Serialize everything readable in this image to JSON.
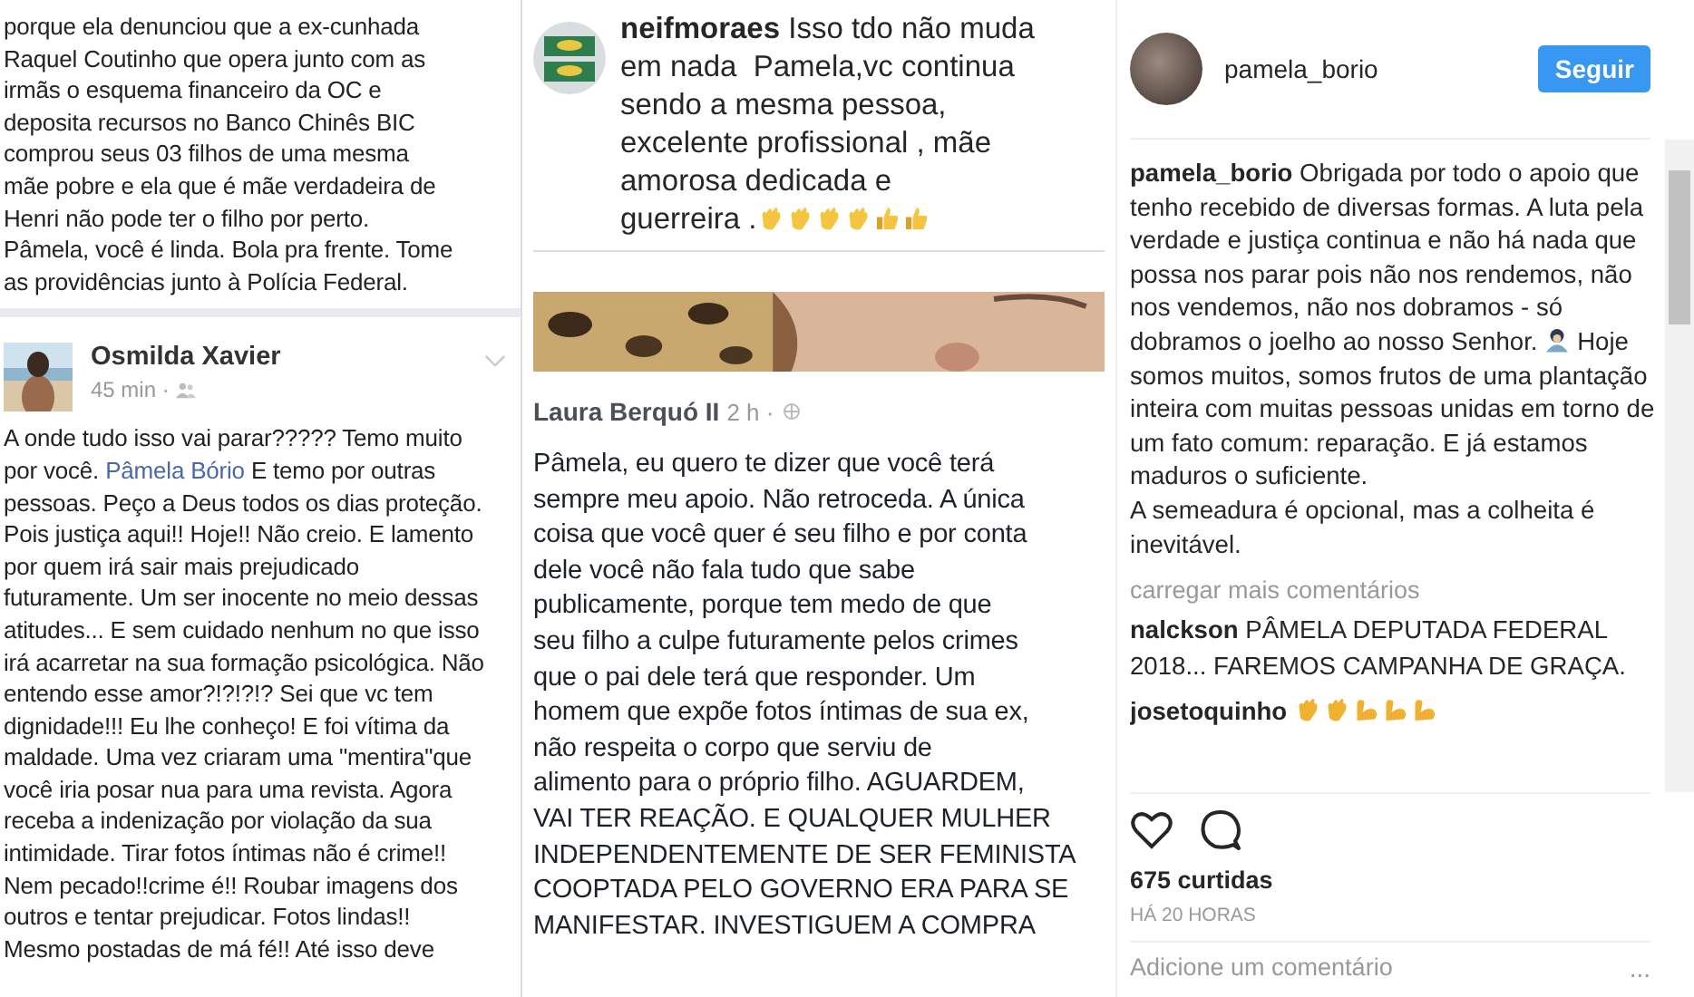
{
  "collage": {
    "left_post": {
      "text": "porque ela denunciou que a ex-cunhada\nRaquel Coutinho que opera junto com as\nirmãs o esquema financeiro da OC e\ndeposita recursos no Banco Chinês BIC\ncomprou seus 03 filhos de uma mesma\nmãe pobre e ela que é mãe verdadeira de\nHenri não pode ter o filho por perto.\nPâmela, você é linda. Bola pra frente. Tome\nas providências junto à Polícia Federal."
    },
    "osmilda_post": {
      "author": "Osmilda Xavier",
      "time": "45 min ·",
      "text_before": "A onde tudo isso vai parar????? Temo muito\npor você.",
      "mention": "Pâmela Bório",
      "text_after": "E temo por outras\npessoas. Peço a Deus todos os dias proteção.\nPois justiça aqui!! Hoje!! Não creio. E lamento\npor quem irá sair mais prejudicado\nfuturamente. Um ser inocente no meio dessas\natitudes... E sem cuidado nenhum no que isso\nirá acarretar na sua formação psicológica. Não\nentendo esse amor?!?!?!? Sei que vc tem\ndignidade!!! Eu lhe conheço! E foi vítima da\nmaldade. Uma vez criaram uma \"mentira\"que\nvocê iria posar nua para uma revista. Agora\nreceba a indenização por violação da sua\nintimidade. Tirar fotos íntimas não é crime!!\nNem pecado!!crime é!! Roubar imagens dos\noutros e tentar prejudicar. Fotos lindas!!\nMesmo postadas de má fé!! Até isso deve"
    },
    "neif_comment": {
      "user": "neifmoraes",
      "text": "Isso tdo não muda\nem nada  Pamela,vc continua\nsendo a mesma pessoa,\nexcelente profissional , mãe\namorosa dedicada e\nguerreira .",
      "reactions": [
        {
          "kind": "clap"
        },
        {
          "kind": "clap"
        },
        {
          "kind": "clap"
        },
        {
          "kind": "clap"
        },
        {
          "kind": "thumb"
        },
        {
          "kind": "thumb"
        }
      ]
    },
    "laura_post": {
      "author": "Laura Berquó II",
      "time": "2 h ·",
      "text": "Pâmela, eu quero te dizer que você terá\nsempre meu apoio. Não retroceda. A única\ncoisa que você quer é seu filho e por conta\ndele você não fala tudo que sabe\npublicamente, porque tem medo de que\nseu filho a culpe futuramente pelos crimes\nque o pai dele terá que responder. Um\nhomem que expõe fotos íntimas de sua ex,\nnão respeita o corpo que serviu de\nalimento para o próprio filho. AGUARDEM,\nVAI TER REAÇÃO. E QUALQUER MULHER\nINDEPENDENTEMENTE DE SER FEMINISTA\nCOOPTADA PELO GOVERNO ERA PARA SE\nMANIFESTAR. INVESTIGUEM A COMPRA"
    }
  },
  "post": {
    "username": "pamela_borio",
    "follow_button": "Seguir",
    "caption": {
      "user": "pamela_borio",
      "text_before": "Obrigada por todo o apoio que tenho recebido de diversas formas. A luta pela verdade e justiça continua e não há nada que possa nos parar pois não nos rendemos, não nos vendemos, não nos dobramos - só dobramos o joelho ao nosso Senhor.",
      "text_after": "Hoje somos muitos, somos frutos de uma plantação inteira com muitas pessoas unidas em torno de um fato comum: reparação. E já estamos maduros o suficiente.",
      "second_paragraph": "A semeadura é opcional, mas a colheita é inevitável."
    },
    "load_more": "carregar mais comentários",
    "comments": [
      {
        "user": "nalckson",
        "text": "PÂMELA DEPUTADA FEDERAL 2018... FAREMOS CAMPANHA DE GRAÇA."
      },
      {
        "user": "josetoquinho",
        "reactions": [
          {
            "kind": "clap"
          },
          {
            "kind": "clap"
          },
          {
            "kind": "muscle"
          },
          {
            "kind": "muscle"
          },
          {
            "kind": "muscle"
          }
        ]
      }
    ],
    "likes": "675 curtidas",
    "time": "HÁ 20 HORAS",
    "comment_field": {
      "placeholder": "Adicione um comentário"
    },
    "more": "..."
  }
}
